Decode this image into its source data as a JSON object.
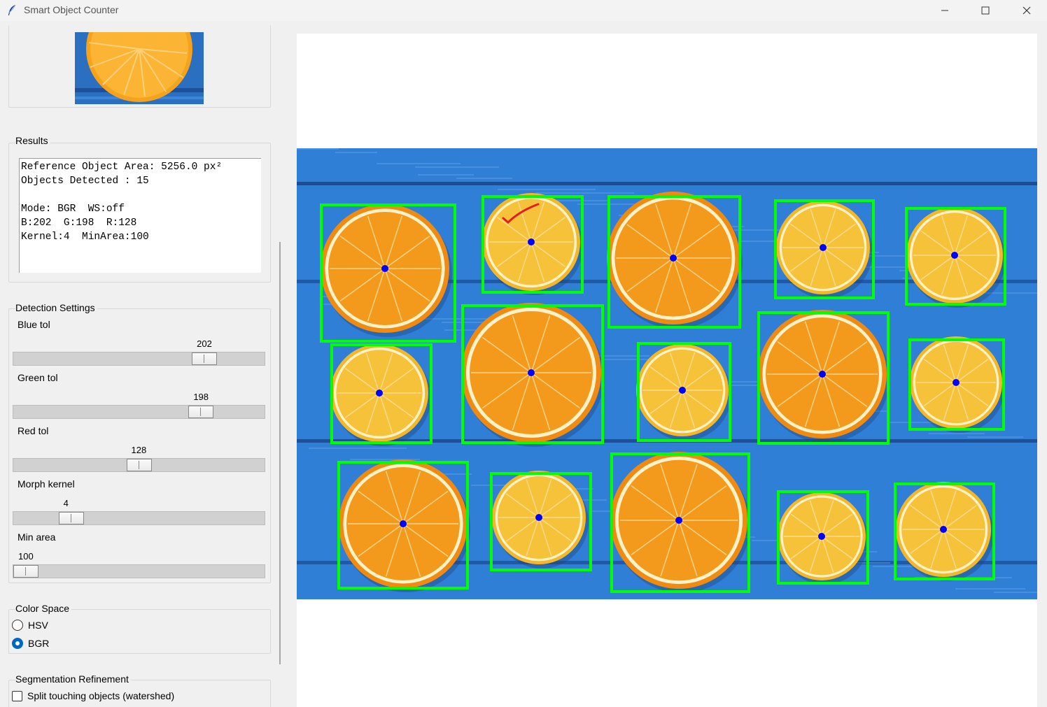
{
  "window": {
    "title": "Smart Object Counter",
    "minimize_icon": "minimize-icon",
    "maximize_icon": "maximize-icon",
    "close_icon": "close-icon"
  },
  "results": {
    "title": "Results",
    "text": "Reference Object Area: 5256.0 px²\nObjects Detected : 15\n\nMode: BGR  WS:off\nB:202  G:198  R:128\nKernel:4  MinArea:100"
  },
  "detection": {
    "title": "Detection Settings",
    "sliders": [
      {
        "label": "Blue tol",
        "value": "202",
        "fraction": 0.79
      },
      {
        "label": "Green tol",
        "value": "198",
        "fraction": 0.775
      },
      {
        "label": "Red tol",
        "value": "128",
        "fraction": 0.5
      },
      {
        "label": "Morph kernel",
        "value": "4",
        "fraction": 0.2
      },
      {
        "label": "Min area",
        "value": "100",
        "fraction": 0.0
      }
    ]
  },
  "color_space": {
    "title": "Color Space",
    "options": [
      "HSV",
      "BGR"
    ],
    "selected": "BGR"
  },
  "segmentation": {
    "title": "Segmentation Refinement",
    "checkbox_label": "Split touching objects (watershed)",
    "checked": false
  },
  "detections": {
    "count": 15,
    "box_color": "#00ff00",
    "center_color": "#0000ff",
    "annotation_color": "#e02020"
  },
  "colors": {
    "background_wood": "#2f7fd6",
    "orange": "#f39a1c",
    "lemon": "#f6c23a"
  }
}
